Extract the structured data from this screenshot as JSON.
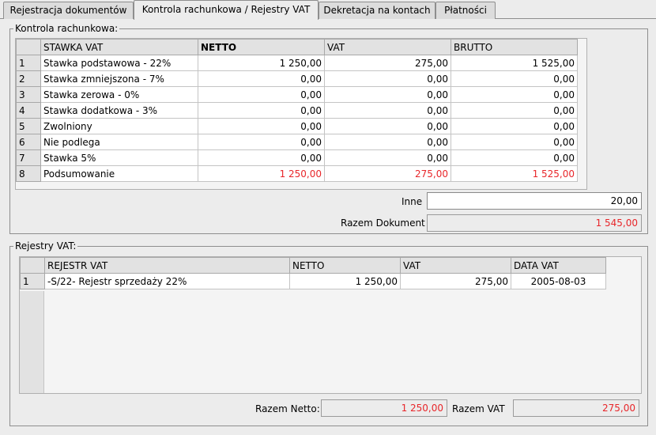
{
  "tabs": [
    {
      "label": "Rejestracja dokumentów",
      "active": false
    },
    {
      "label": "Kontrola rachunkowa / Rejestry VAT",
      "active": true
    },
    {
      "label": "Dekretacja na kontach",
      "active": false
    },
    {
      "label": "Płatności",
      "active": false
    }
  ],
  "kontrola": {
    "legend": "Kontrola rachunkowa:",
    "columns": {
      "stawka": "STAWKA VAT",
      "netto": "NETTO",
      "vat": "VAT",
      "brutto": "BRUTTO"
    },
    "rows": [
      {
        "n": "1",
        "stawka": "Stawka podstawowa - 22%",
        "netto": "1 250,00",
        "vat": "275,00",
        "brutto": "1 525,00"
      },
      {
        "n": "2",
        "stawka": "Stawka zmniejszona - 7%",
        "netto": "0,00",
        "vat": "0,00",
        "brutto": "0,00"
      },
      {
        "n": "3",
        "stawka": "Stawka zerowa - 0%",
        "netto": "0,00",
        "vat": "0,00",
        "brutto": "0,00"
      },
      {
        "n": "4",
        "stawka": "Stawka dodatkowa - 3%",
        "netto": "0,00",
        "vat": "0,00",
        "brutto": "0,00"
      },
      {
        "n": "5",
        "stawka": "Zwolniony",
        "netto": "0,00",
        "vat": "0,00",
        "brutto": "0,00"
      },
      {
        "n": "6",
        "stawka": "Nie podlega",
        "netto": "0,00",
        "vat": "0,00",
        "brutto": "0,00"
      },
      {
        "n": "7",
        "stawka": "Stawka 5%",
        "netto": "0,00",
        "vat": "0,00",
        "brutto": "0,00"
      },
      {
        "n": "8",
        "stawka": "Podsumowanie",
        "netto": "1 250,00",
        "vat": "275,00",
        "brutto": "1 525,00"
      }
    ],
    "inne_label": "Inne",
    "inne_value": "20,00",
    "razem_label": "Razem Dokument",
    "razem_value": "1 545,00"
  },
  "rejestry": {
    "legend": "Rejestry VAT:",
    "columns": {
      "rejestr": "REJESTR VAT",
      "netto": "NETTO",
      "vat": "VAT",
      "data": "DATA VAT"
    },
    "rows": [
      {
        "n": "1",
        "rejestr": "-S/22- Rejestr sprzedaży 22%",
        "netto": "1 250,00",
        "vat": "275,00",
        "data": "2005-08-03"
      }
    ],
    "razem_netto_label": "Razem Netto:",
    "razem_netto_value": "1 250,00",
    "razem_vat_label": "Razem VAT",
    "razem_vat_value": "275,00"
  },
  "colors": {
    "summary_red": "#e8262a"
  }
}
